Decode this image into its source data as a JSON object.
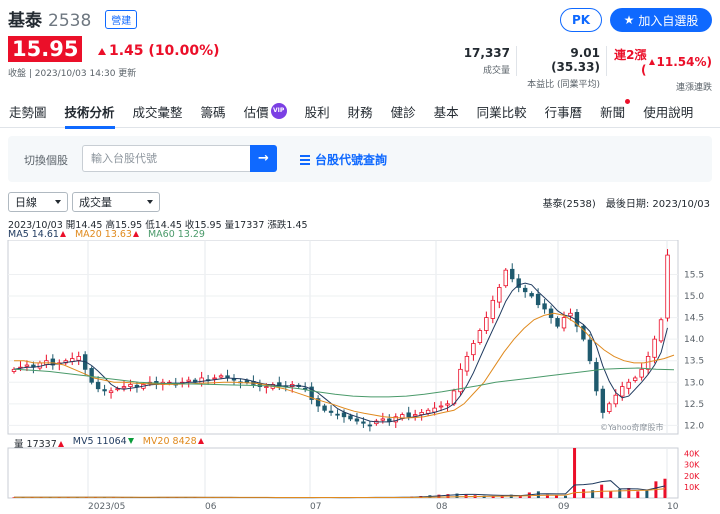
{
  "stock": {
    "name": "基泰",
    "code": "2538",
    "tag": "營建",
    "price": "15.95",
    "change": "1.45 (10.00%)",
    "close_note": "收盤 | 2023/10/03 14:30 更新"
  },
  "header": {
    "pk_label": "PK",
    "fav_label": "加入自選股"
  },
  "stats": [
    {
      "value": "17,337",
      "label": "成交量"
    },
    {
      "value": "9.01 (35.33)",
      "label": "本益比 (同業平均)"
    },
    {
      "value": "連2漲 (",
      "value2": "11.54%)",
      "label": "連漲連跌"
    }
  ],
  "tabs": [
    "走勢圖",
    "技術分析",
    "成交彙整",
    "籌碼",
    "估價",
    "股利",
    "財務",
    "健診",
    "基本",
    "同業比較",
    "行事曆",
    "新聞",
    "使用說明"
  ],
  "vip_label": "VIP",
  "search": {
    "label": "切換個股",
    "placeholder": "輸入台股代號",
    "lookup": "台股代號查詢"
  },
  "selects": {
    "period": "日線",
    "indicator": "成交量"
  },
  "chart_meta": "基泰(2538)　最後日期: 2023/10/03",
  "ohlc_line": "2023/10/03 開14.45 高15.95 低14.45 收15.95 量17337 漲跌1.45",
  "ma": {
    "ma5": "MA5 14.61",
    "ma20": "MA20 13.63",
    "ma60": "MA60 13.29"
  },
  "vol_legend": {
    "vol": "量 17337",
    "mv5": "MV5 11064",
    "mv20": "MV20 8428"
  },
  "watermark": "©Yahoo奇摩股市",
  "x_ticks": [
    "2023/05",
    "06",
    "07",
    "08",
    "09",
    "10"
  ],
  "colors": {
    "up": "#eb0f29",
    "down": "#1f5a6e",
    "accent": "#0f69ff",
    "ma5": "#1f3a5f",
    "ma20": "#e08a1e",
    "ma60": "#4a9a6a"
  },
  "chart_data": {
    "type": "candlestick",
    "ylim": [
      11.8,
      16.3
    ],
    "yticks": [
      12.0,
      12.5,
      13.0,
      13.5,
      14.0,
      14.5,
      15.0,
      15.5
    ],
    "vol_ticks": [
      "40K",
      "30K",
      "20K",
      "10K"
    ],
    "vol_max": 45000,
    "close_path": [
      13.3,
      13.35,
      13.4,
      13.35,
      13.45,
      13.5,
      13.4,
      13.45,
      13.5,
      13.55,
      13.6,
      13.3,
      13.0,
      12.85,
      12.8,
      12.8,
      12.85,
      12.9,
      12.95,
      12.9,
      12.95,
      13.0,
      12.95,
      13.0,
      13.0,
      12.95,
      13.0,
      13.05,
      13.0,
      13.1,
      13.05,
      13.1,
      13.15,
      13.1,
      13.05,
      13.0,
      13.0,
      12.95,
      12.9,
      12.9,
      12.95,
      12.9,
      12.9,
      12.95,
      12.9,
      12.85,
      12.6,
      12.45,
      12.35,
      12.3,
      12.25,
      12.2,
      12.15,
      12.1,
      12.05,
      12.0,
      12.1,
      12.15,
      12.1,
      12.2,
      12.25,
      12.2,
      12.25,
      12.3,
      12.35,
      12.4,
      12.45,
      12.5,
      12.8,
      13.3,
      13.6,
      13.9,
      14.2,
      14.5,
      14.9,
      15.2,
      15.6,
      15.4,
      15.2,
      15.1,
      15.0,
      14.8,
      14.7,
      14.5,
      14.3,
      14.5,
      14.6,
      14.3,
      14.0,
      13.5,
      12.8,
      12.3,
      12.5,
      12.7,
      12.9,
      13.0,
      13.1,
      13.3,
      13.6,
      14.0,
      14.45,
      15.95
    ],
    "ma20_path": [
      13.5,
      13.5,
      13.45,
      13.45,
      13.45,
      13.4,
      13.3,
      13.2,
      13.1,
      13.05,
      13.0,
      13.0,
      12.98,
      12.97,
      12.96,
      12.95,
      12.95,
      12.96,
      12.97,
      12.98,
      12.99,
      13.0,
      13.0,
      12.99,
      12.98,
      12.95,
      12.9,
      12.85,
      12.78,
      12.7,
      12.62,
      12.55,
      12.48,
      12.4,
      12.33,
      12.28,
      12.24,
      12.2,
      12.18,
      12.17,
      12.18,
      12.2,
      12.25,
      12.3,
      12.35,
      12.5,
      12.75,
      13.0,
      13.35,
      13.7,
      14.0,
      14.25,
      14.45,
      14.55,
      14.6,
      14.55,
      14.4,
      14.2,
      13.95,
      13.75,
      13.6,
      13.5,
      13.45,
      13.45,
      13.5,
      13.55,
      13.63
    ],
    "ma60_path": [
      13.3,
      13.28,
      13.25,
      13.2,
      13.15,
      13.1,
      13.05,
      13.0,
      12.98,
      12.97,
      12.96,
      12.95,
      12.94,
      12.93,
      12.92,
      12.9,
      12.85,
      12.78,
      12.72,
      12.68,
      12.66,
      12.66,
      12.68,
      12.72,
      12.78,
      12.85,
      12.92,
      13.0,
      13.05,
      13.1,
      13.15,
      13.2,
      13.25,
      13.3,
      13.32,
      13.33,
      13.3,
      13.29
    ],
    "volume_path": [
      600,
      800,
      500,
      700,
      900,
      600,
      500,
      700,
      800,
      600,
      500,
      400,
      600,
      500,
      400,
      500,
      600,
      500,
      700,
      600,
      500,
      400,
      500,
      600,
      500,
      400,
      300,
      500,
      400,
      300,
      400,
      500,
      300,
      400,
      500,
      400,
      300,
      400,
      500,
      600,
      700,
      500,
      600,
      800,
      1200,
      1800,
      2500,
      3000,
      3500,
      4000,
      3000,
      2500,
      2000,
      1500,
      2500,
      3000,
      2000,
      5000,
      6000,
      3000,
      2500,
      2000,
      45000,
      8000,
      7000,
      12000,
      6000,
      8000,
      9000,
      6000,
      7000,
      15000,
      17337
    ]
  }
}
